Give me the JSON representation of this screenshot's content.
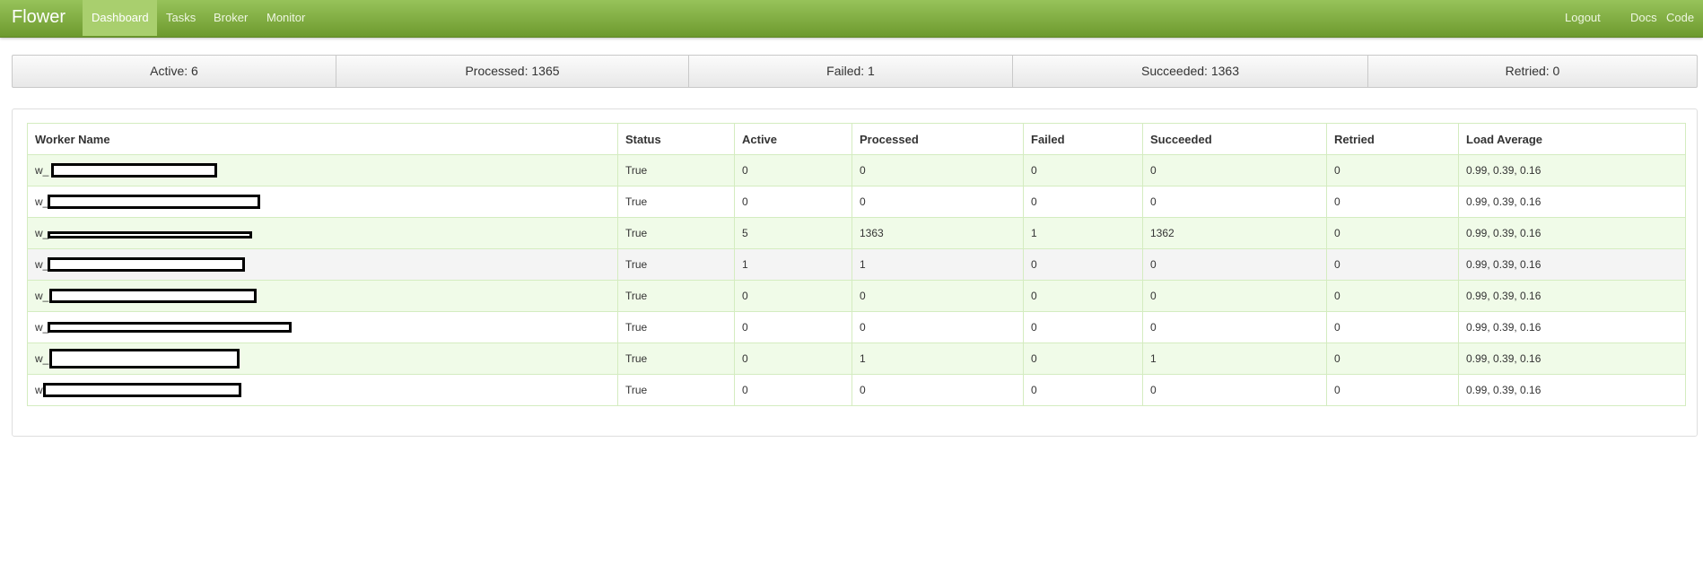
{
  "navbar": {
    "brand": "Flower",
    "left_items": [
      "Dashboard",
      "Tasks",
      "Broker",
      "Monitor"
    ],
    "active": "Dashboard",
    "right_items": [
      "Logout",
      "Docs",
      "Code"
    ],
    "colors": {
      "bar": "#7aa73a",
      "active": "#a9cf6e"
    }
  },
  "stats": {
    "active": "Active: 6",
    "processed": "Processed: 1365",
    "failed": "Failed: 1",
    "succeeded": "Succeeded: 1363",
    "retried": "Retried: 0"
  },
  "table": {
    "headers": [
      "Worker Name",
      "Status",
      "Active",
      "Processed",
      "Failed",
      "Succeeded",
      "Retried",
      "Load Average"
    ],
    "rows": [
      {
        "name": "w_",
        "status": "True",
        "active": "0",
        "processed": "0",
        "failed": "0",
        "succeeded": "0",
        "retried": "0",
        "load": "0.99, 0.39, 0.16"
      },
      {
        "name": "w_",
        "status": "True",
        "active": "0",
        "processed": "0",
        "failed": "0",
        "succeeded": "0",
        "retried": "0",
        "load": "0.99, 0.39, 0.16"
      },
      {
        "name": "w_",
        "status": "True",
        "active": "5",
        "processed": "1363",
        "failed": "1",
        "succeeded": "1362",
        "retried": "0",
        "load": "0.99, 0.39, 0.16"
      },
      {
        "name": "w_",
        "status": "True",
        "active": "1",
        "processed": "1",
        "failed": "0",
        "succeeded": "0",
        "retried": "0",
        "load": "0.99, 0.39, 0.16"
      },
      {
        "name": "w_",
        "status": "True",
        "active": "0",
        "processed": "0",
        "failed": "0",
        "succeeded": "0",
        "retried": "0",
        "load": "0.99, 0.39, 0.16"
      },
      {
        "name": "w_",
        "status": "True",
        "active": "0",
        "processed": "0",
        "failed": "0",
        "succeeded": "0",
        "retried": "0",
        "load": "0.99, 0.39, 0.16"
      },
      {
        "name": "w_",
        "status": "True",
        "active": "0",
        "processed": "1",
        "failed": "0",
        "succeeded": "1",
        "retried": "0",
        "load": "0.99, 0.39, 0.16"
      },
      {
        "name": "w",
        "status": "True",
        "active": "0",
        "processed": "0",
        "failed": "0",
        "succeeded": "0",
        "retried": "0",
        "load": "0.99, 0.39, 0.16"
      }
    ]
  }
}
